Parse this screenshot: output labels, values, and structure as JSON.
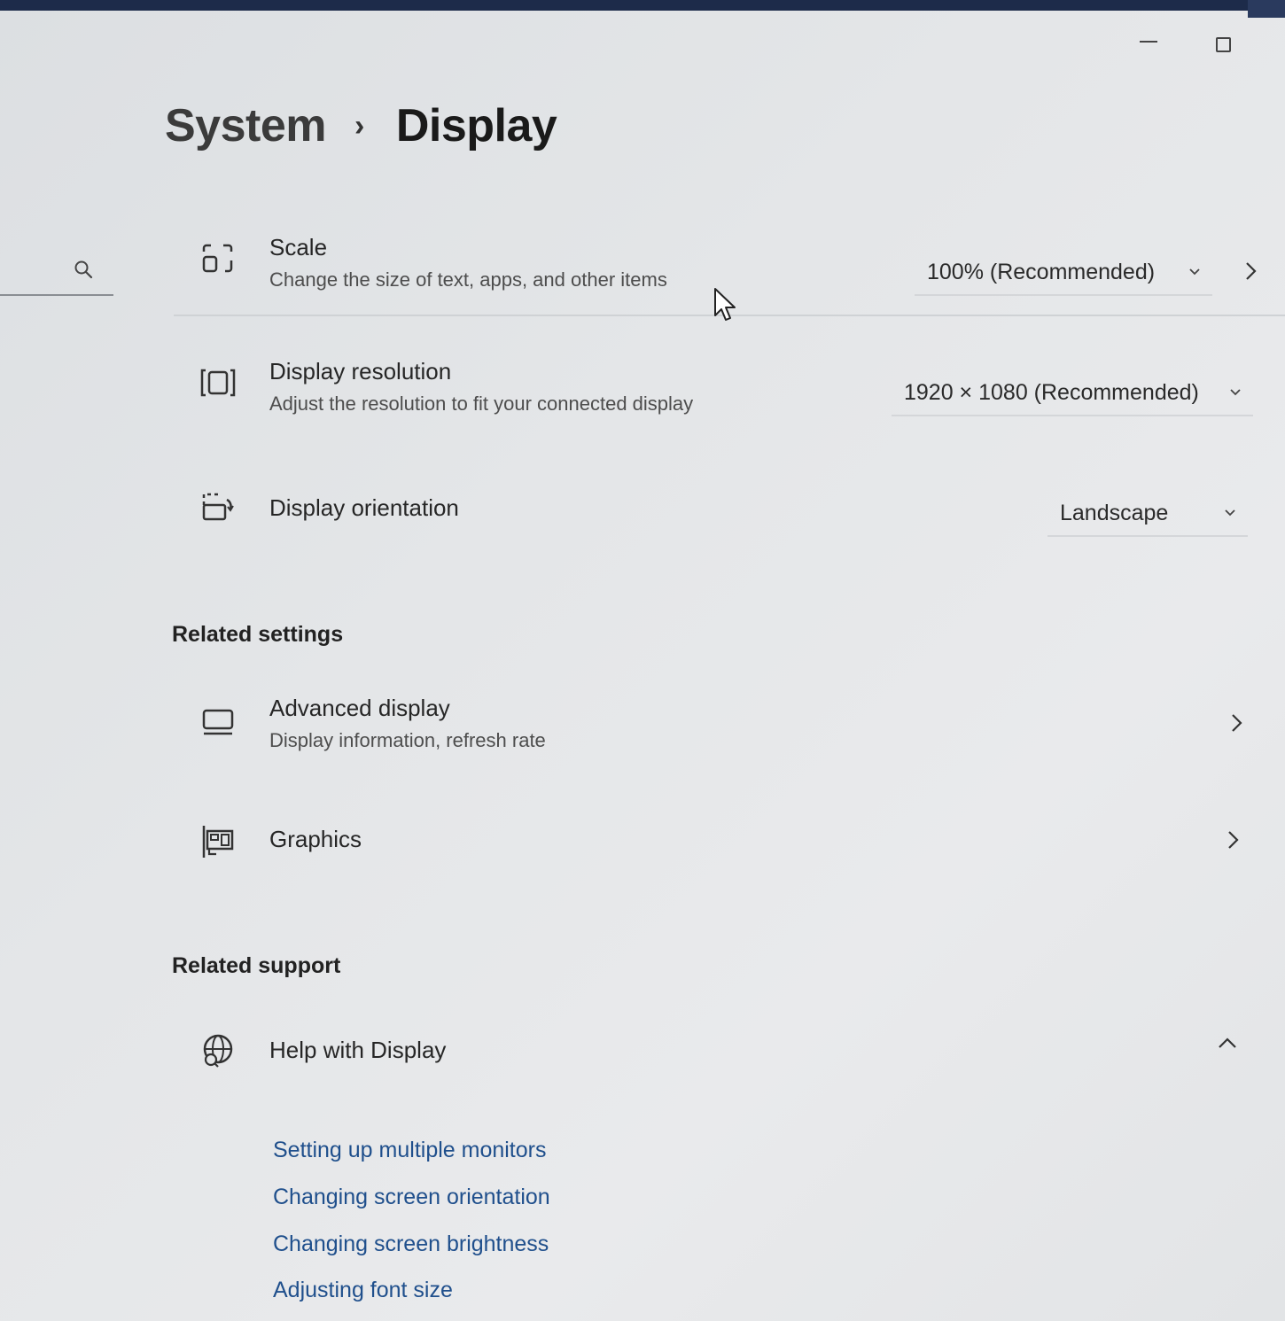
{
  "breadcrumb": {
    "parent": "System",
    "separator": "›",
    "current": "Display"
  },
  "settings": [
    {
      "title": "Scale",
      "subtitle": "Change the size of text, apps, and other items",
      "value": "100% (Recommended)",
      "icon": "scale-icon"
    },
    {
      "title": "Display resolution",
      "subtitle": "Adjust the resolution to fit your connected display",
      "value": "1920 × 1080 (Recommended)",
      "icon": "resolution-icon"
    },
    {
      "title": "Display orientation",
      "value": "Landscape",
      "icon": "orientation-icon"
    }
  ],
  "related_settings": {
    "heading": "Related settings",
    "items": [
      {
        "title": "Advanced display",
        "subtitle": "Display information, refresh rate",
        "icon": "monitor-icon"
      },
      {
        "title": "Graphics",
        "icon": "graphics-card-icon"
      }
    ]
  },
  "related_support": {
    "heading": "Related support",
    "help_title": "Help with Display",
    "icon": "globe-help-icon",
    "links": [
      "Setting up multiple monitors",
      "Changing screen orientation",
      "Changing screen brightness",
      "Adjusting font size"
    ]
  },
  "colors": {
    "link": "#1f4f8c",
    "background": "#e4e6e8",
    "titlebar": "#1d2b4a"
  }
}
